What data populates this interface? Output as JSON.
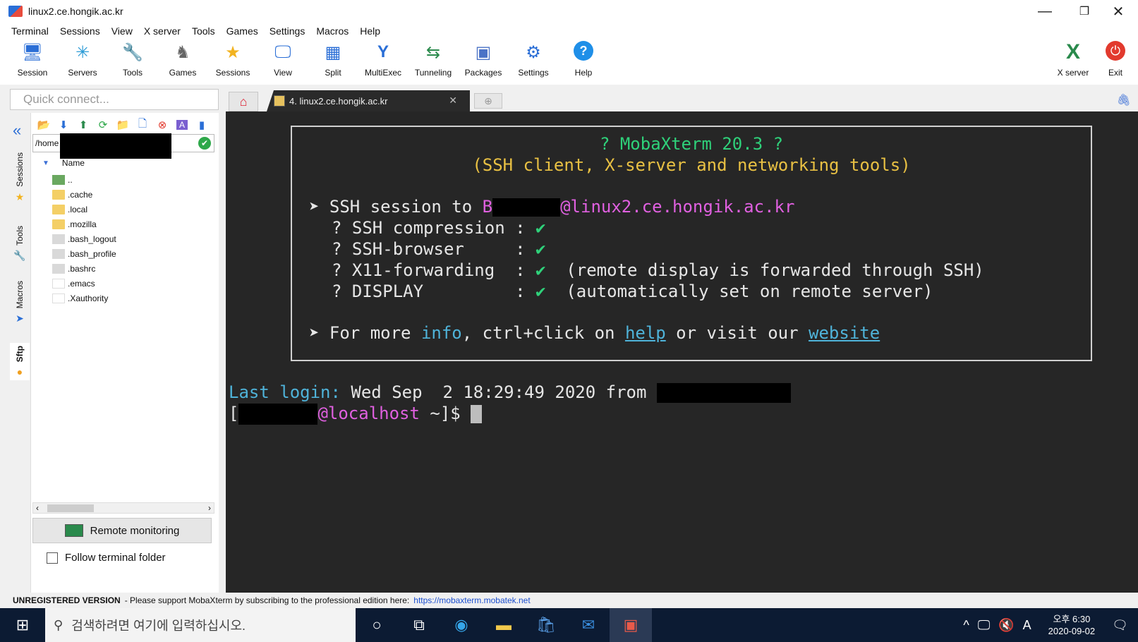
{
  "window": {
    "title": "linux2.ce.hongik.ac.kr",
    "controls": [
      "—",
      "❐",
      "✕"
    ]
  },
  "menu": [
    "Terminal",
    "Sessions",
    "View",
    "X server",
    "Tools",
    "Games",
    "Settings",
    "Macros",
    "Help"
  ],
  "toolbar": [
    {
      "label": "Session",
      "icon": "session-icon",
      "glyph": "🖥"
    },
    {
      "label": "Servers",
      "icon": "servers-icon",
      "glyph": "✳"
    },
    {
      "label": "Tools",
      "icon": "tools-icon",
      "glyph": "🔧"
    },
    {
      "label": "Games",
      "icon": "games-icon",
      "glyph": "♞"
    },
    {
      "label": "Sessions",
      "icon": "star-icon",
      "glyph": "★"
    },
    {
      "label": "View",
      "icon": "view-icon",
      "glyph": "🖵"
    },
    {
      "label": "Split",
      "icon": "split-icon",
      "glyph": "▦"
    },
    {
      "label": "MultiExec",
      "icon": "multiexec-icon",
      "glyph": "Y"
    },
    {
      "label": "Tunneling",
      "icon": "tunneling-icon",
      "glyph": "⇆"
    },
    {
      "label": "Packages",
      "icon": "packages-icon",
      "glyph": "▣"
    },
    {
      "label": "Settings",
      "icon": "gears-icon",
      "glyph": "⚙"
    },
    {
      "label": "Help",
      "icon": "help-icon",
      "glyph": "?"
    }
  ],
  "toolbar_right": [
    {
      "label": "X server",
      "icon": "x-server-icon",
      "glyph": "X"
    },
    {
      "label": "Exit",
      "icon": "power-icon",
      "glyph": "⏻"
    }
  ],
  "quick_connect": {
    "placeholder": "Quick connect..."
  },
  "tabs": {
    "home_glyph": "⌂",
    "active_label": "4. linux2.ce.hongik.ac.kr",
    "close_glyph": "✕",
    "new_glyph": "⊕",
    "clip_glyph": "🖇"
  },
  "side_tabs": [
    {
      "label": "Sessions",
      "icon": "star-icon",
      "glyph": "★"
    },
    {
      "label": "Tools",
      "icon": "tools-icon",
      "glyph": "🔧"
    },
    {
      "label": "Macros",
      "icon": "macros-icon",
      "glyph": "➤"
    },
    {
      "label": "Sftp",
      "icon": "sftp-icon",
      "glyph": "●"
    }
  ],
  "sftp": {
    "collapse_glyph": "«",
    "toolbar_glyphs": [
      "📂",
      "⬇",
      "⬆",
      "⟳",
      "📁",
      "🗋",
      "⊗",
      "A",
      "▮"
    ],
    "path": "/home",
    "path_ok_glyph": "✔",
    "column_name": "Name",
    "files": [
      {
        "name": "..",
        "type": "up"
      },
      {
        "name": ".cache",
        "type": "folder"
      },
      {
        "name": ".local",
        "type": "folder"
      },
      {
        "name": ".mozilla",
        "type": "folder"
      },
      {
        "name": ".bash_logout",
        "type": "file"
      },
      {
        "name": ".bash_profile",
        "type": "file"
      },
      {
        "name": ".bashrc",
        "type": "file"
      },
      {
        "name": ".emacs",
        "type": "blank"
      },
      {
        "name": ".Xauthority",
        "type": "blank"
      }
    ],
    "remote_monitoring": "Remote monitoring",
    "follow_folder": "Follow terminal folder"
  },
  "terminal": {
    "banner_title": "? MobaXterm 20.3 ?",
    "banner_subtitle": "(SSH client, X-server and networking tools)",
    "ssh_prefix": "➤ SSH session to ",
    "ssh_user_initial": "B",
    "ssh_host": "@linux2.ce.hongik.ac.kr",
    "checks": [
      {
        "label": "? SSH compression : ",
        "mark": "✔",
        "note": ""
      },
      {
        "label": "? SSH-browser     : ",
        "mark": "✔",
        "note": ""
      },
      {
        "label": "? X11-forwarding  : ",
        "mark": "✔",
        "note": "  (remote display is forwarded through SSH)"
      },
      {
        "label": "? DISPLAY         : ",
        "mark": "✔",
        "note": "  (automatically set on remote server)"
      }
    ],
    "more_prefix": "➤ For more ",
    "more_info": "info",
    "more_mid": ", ctrl+click on ",
    "more_help": "help",
    "more_or": " or visit our ",
    "more_site": "website",
    "last_login_label": "Last login:",
    "last_login_value": " Wed Sep  2 18:29:49 2020 from ",
    "prompt_open": "[",
    "prompt_host": "@localhost",
    "prompt_tail": " ~]$ "
  },
  "status": {
    "bold": "UNREGISTERED VERSION",
    "text": " - Please support MobaXterm by subscribing to the professional edition here: ",
    "url": "https://mobaxterm.mobatek.net"
  },
  "taskbar": {
    "start_glyph": "⊞",
    "search_glyph": "⚲",
    "search_placeholder": "검색하려면 여기에 입력하십시오.",
    "apps": [
      {
        "name": "cortana-icon",
        "glyph": "○"
      },
      {
        "name": "task-view-icon",
        "glyph": "⧉"
      },
      {
        "name": "edge-icon",
        "glyph": "◉"
      },
      {
        "name": "file-explorer-icon",
        "glyph": "▬"
      },
      {
        "name": "store-icon",
        "glyph": "🛍"
      },
      {
        "name": "mail-icon",
        "glyph": "✉"
      },
      {
        "name": "mobaxterm-icon",
        "glyph": "▣"
      }
    ],
    "tray_glyphs": [
      "^",
      "🖵",
      "🔇",
      "A"
    ],
    "time": "오후 6:30",
    "date": "2020-09-02",
    "notify_glyph": "🗨"
  }
}
